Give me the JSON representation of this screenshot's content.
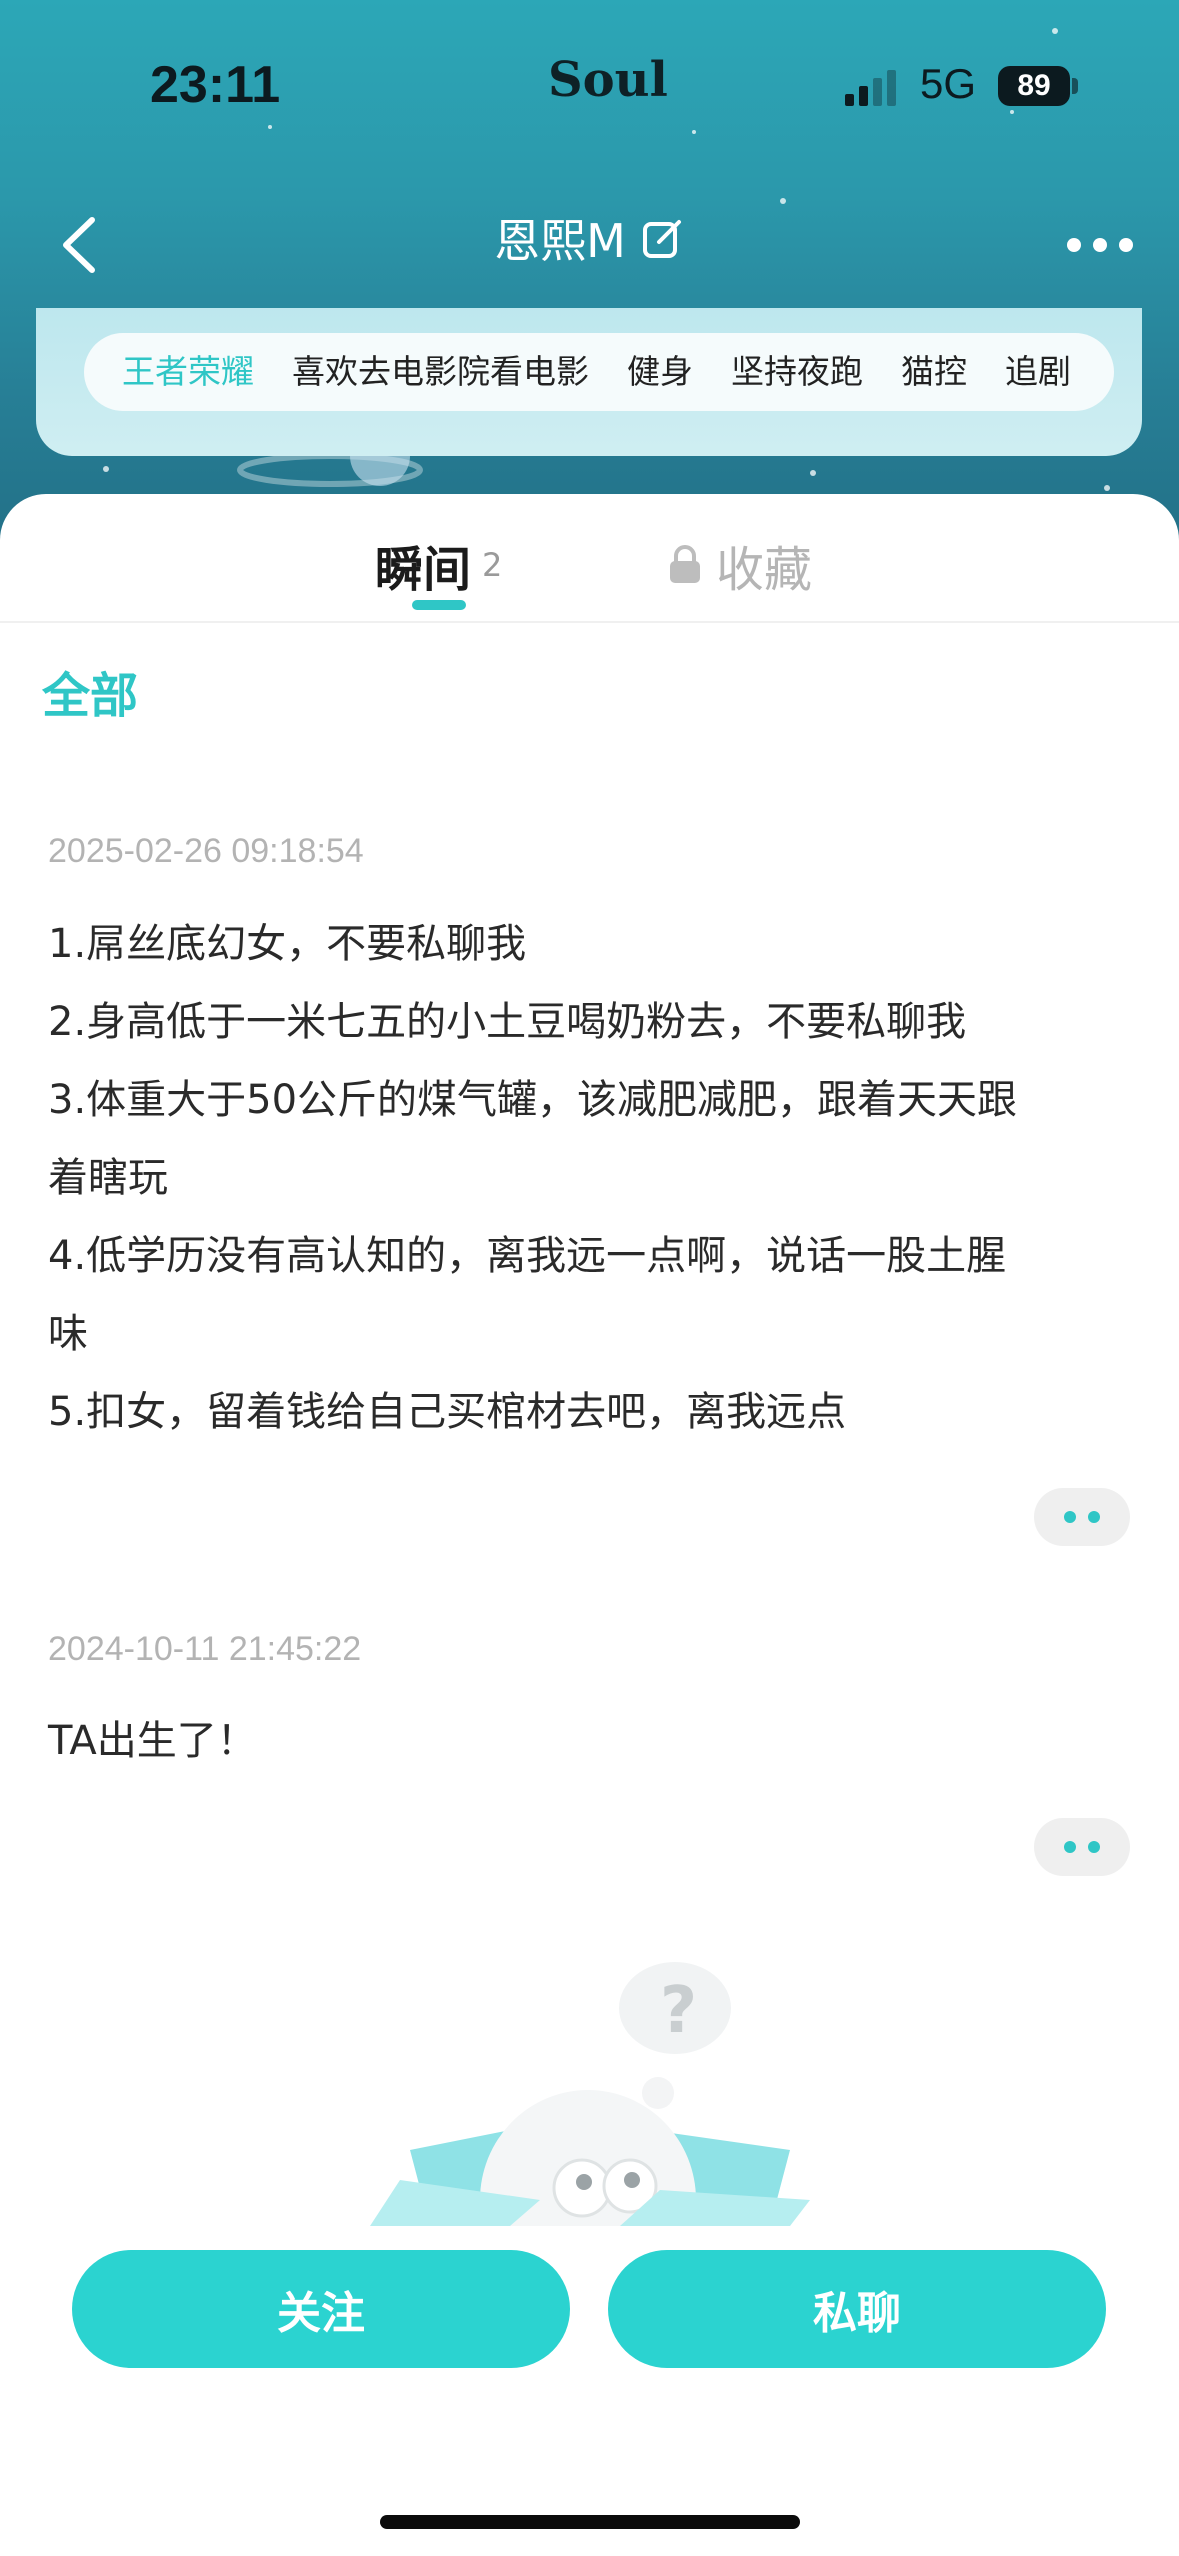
{
  "status_bar": {
    "time": "23:11",
    "carrier": "Soul",
    "network": "5G",
    "battery": "89"
  },
  "header": {
    "title": "恩熙M",
    "back_icon": "chevron-left-icon",
    "edit_icon": "edit-icon",
    "more_icon": "more-horizontal-icon"
  },
  "tags": [
    "王者荣耀",
    "喜欢去电影院看电影",
    "健身",
    "坚持夜跑",
    "猫控",
    "追剧"
  ],
  "tabs": {
    "moments": "瞬间",
    "moments_count": "2",
    "favorites": "收藏"
  },
  "filter": {
    "label": "全部"
  },
  "posts": [
    {
      "time": "2025-02-26 09:18:54",
      "lines": [
        "1.屌丝底幻女，不要私聊我",
        "2.身高低于一米七五的小土豆喝奶粉去，不要私聊我",
        "3.体重大于50公斤的煤气罐，该减肥减肥，跟着天天跟",
        "着瞎玩",
        "4.低学历没有高认知的，离我远一点啊，说话一股土腥",
        "味",
        "5.扣女，留着钱给自己买棺材去吧，离我远点"
      ]
    },
    {
      "time": "2024-10-11 21:45:22",
      "lines": [
        "TA出生了！"
      ]
    }
  ],
  "actions": {
    "follow": "关注",
    "chat": "私聊"
  },
  "colors": {
    "accent": "#2fc6c6",
    "button": "#2bd3d0",
    "hero_top": "#2ca7b7",
    "hero_bottom": "#226f86"
  }
}
